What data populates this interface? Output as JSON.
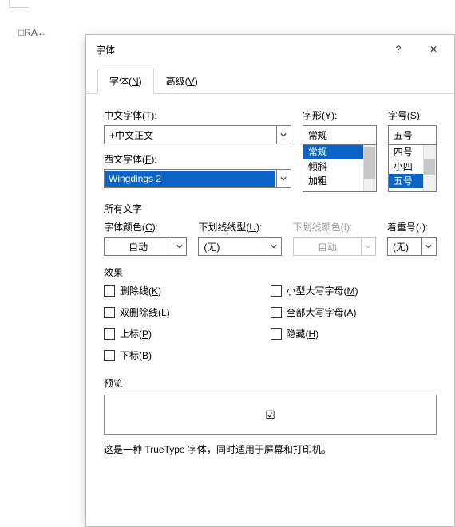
{
  "page": {
    "snippet": "□RA←"
  },
  "dialog": {
    "title": "字体",
    "help_glyph": "?",
    "close_glyph": "✕"
  },
  "tabs": [
    {
      "label_pre": "字体(",
      "hot": "N",
      "label_post": ")"
    },
    {
      "label_pre": "高级(",
      "hot": "V",
      "label_post": ")"
    }
  ],
  "labels": {
    "cn_font_pre": "中文字体(",
    "cn_font_hot": "T",
    "cn_font_post": "):",
    "style_pre": "字形(",
    "style_hot": "Y",
    "style_post": "):",
    "size_pre": "字号(",
    "size_hot": "S",
    "size_post": "):",
    "latin_font_pre": "西文字体(",
    "latin_font_hot": "F",
    "latin_font_post": "):",
    "all_text": "所有文字",
    "font_color_pre": "字体颜色(",
    "font_color_hot": "C",
    "font_color_post": "):",
    "und_style_pre": "下划线线型(",
    "und_style_hot": "U",
    "und_style_post": "):",
    "und_color": "下划线颜色(I):",
    "emphasis": "着重号(·):",
    "effects": "效果",
    "preview": "预览"
  },
  "fields": {
    "cn_font": "+中文正文",
    "latin_font": "Wingdings 2",
    "style_value": "常规",
    "style_options": [
      "常规",
      "倾斜",
      "加粗"
    ],
    "size_value": "五号",
    "size_options": [
      "四号",
      "小四",
      "五号"
    ],
    "font_color": "自动",
    "und_style": "(无)",
    "und_color": "自动",
    "emphasis": "(无)"
  },
  "checks": {
    "strike_pre": "删除线(",
    "strike_hot": "K",
    "strike_post": ")",
    "dstrike_pre": "双删除线(",
    "dstrike_hot": "L",
    "dstrike_post": ")",
    "super_pre": "上标(",
    "super_hot": "P",
    "super_post": ")",
    "sub_pre": "下标(",
    "sub_hot": "B",
    "sub_post": ")",
    "smallcaps_pre": "小型大写字母(",
    "smallcaps_hot": "M",
    "smallcaps_post": ")",
    "allcaps_pre": "全部大写字母(",
    "allcaps_hot": "A",
    "allcaps_post": ")",
    "hidden_pre": "隐藏(",
    "hidden_hot": "H",
    "hidden_post": ")"
  },
  "preview_sample": "☑",
  "desc": "这是一种 TrueType 字体，同时适用于屏幕和打印机。"
}
